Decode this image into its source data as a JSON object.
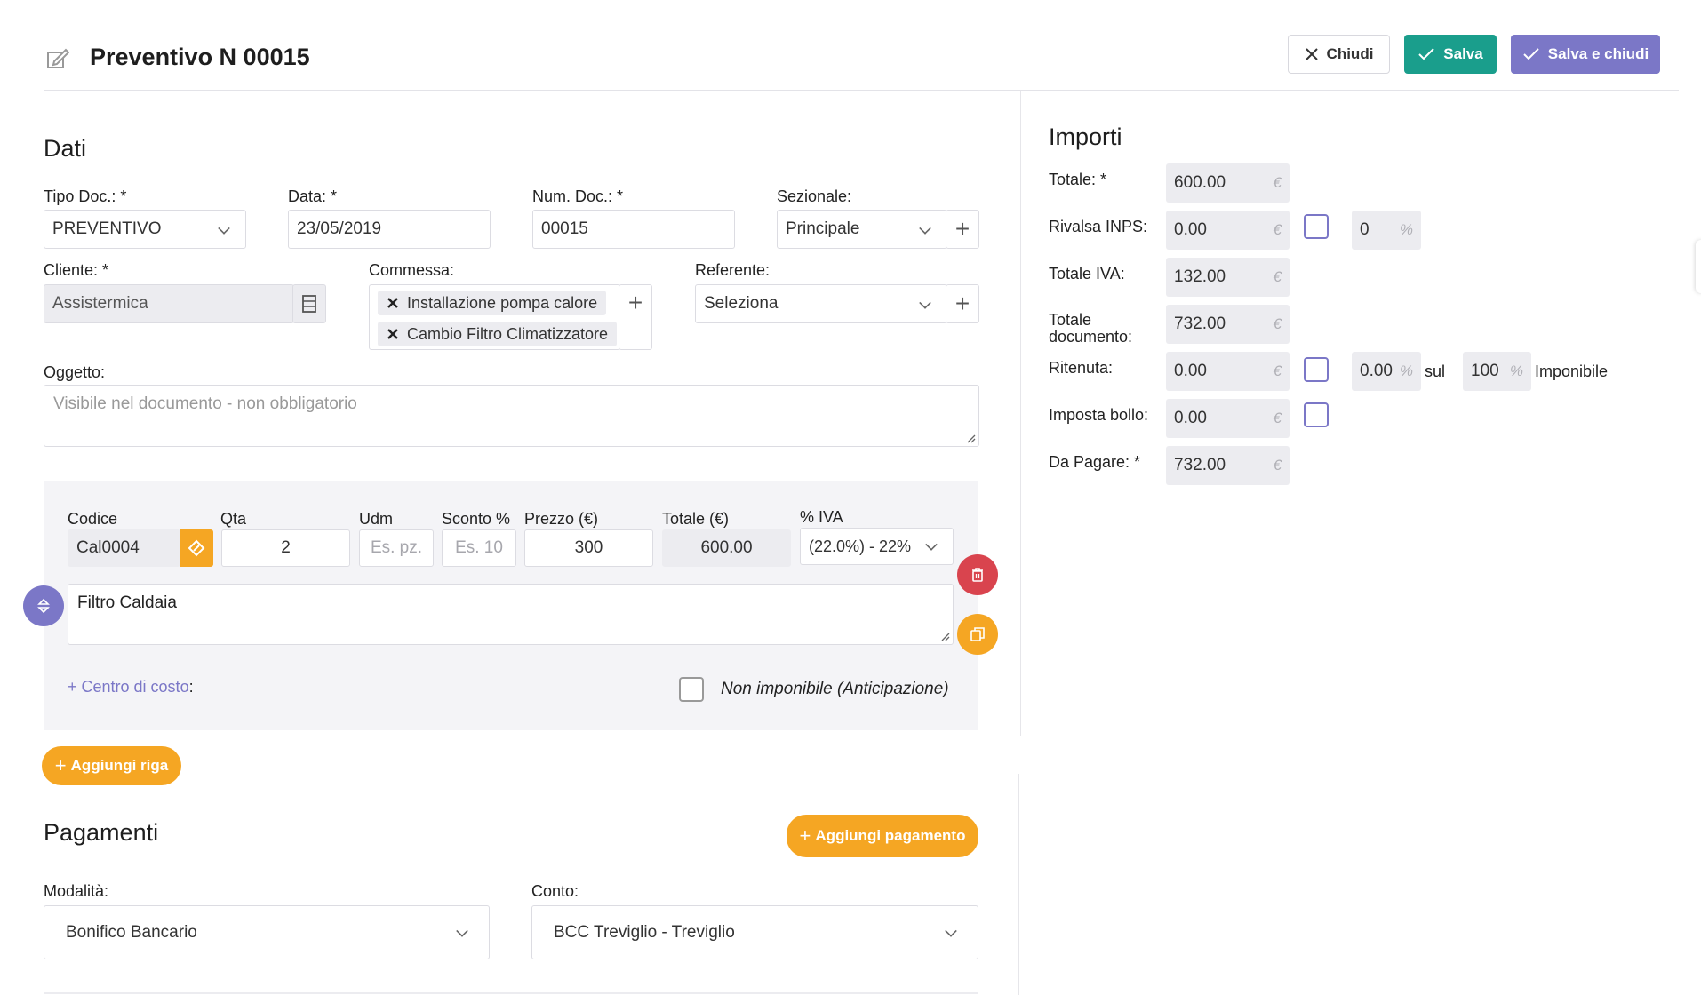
{
  "header": {
    "title": "Preventivo N 00015",
    "close_label": "Chiudi",
    "save_label": "Salva",
    "save_close_label": "Salva e chiudi"
  },
  "dati": {
    "title": "Dati",
    "tipo_doc_label": "Tipo Doc.: *",
    "tipo_doc_value": "PREVENTIVO",
    "data_label": "Data: *",
    "data_value": "23/05/2019",
    "num_doc_label": "Num. Doc.: *",
    "num_doc_value": "00015",
    "sezionale_label": "Sezionale:",
    "sezionale_value": "Principale",
    "cliente_label": "Cliente: *",
    "cliente_value": "Assistermica",
    "commessa_label": "Commessa:",
    "commessa_tags": [
      "Installazione pompa calore",
      "Cambio Filtro Climatizzatore"
    ],
    "referente_label": "Referente:",
    "referente_value": "Seleziona",
    "oggetto_label": "Oggetto:",
    "oggetto_placeholder": "Visibile nel documento - non obbligatorio"
  },
  "riga": {
    "codice_label": "Codice",
    "codice_value": "Cal0004",
    "qta_label": "Qta",
    "qta_value": "2",
    "udm_label": "Udm",
    "udm_placeholder": "Es. pz.",
    "sconto_label": "Sconto %",
    "sconto_placeholder": "Es. 10",
    "prezzo_label": "Prezzo (€)",
    "prezzo_value": "300",
    "totale_label": "Totale (€)",
    "totale_value": "600.00",
    "iva_label": "% IVA",
    "iva_value": "(22.0%) - 22%",
    "descrizione": "Filtro Caldaia",
    "centro_costo_prefix": "+ Centro di costo",
    "centro_costo_colon": ":",
    "non_imponibile": "Non imponibile (Anticipazione)",
    "aggiungi_riga": "Aggiungi riga"
  },
  "pagamenti": {
    "title": "Pagamenti",
    "aggiungi_pagamento": "Aggiungi pagamento",
    "modalita_label": "Modalità:",
    "modalita_value": "Bonifico Bancario",
    "conto_label": "Conto:",
    "conto_value": "BCC Treviglio - Treviglio"
  },
  "importi": {
    "title": "Importi",
    "totale_label": "Totale: *",
    "totale_value": "600.00",
    "rivalsa_label": "Rivalsa INPS:",
    "rivalsa_value": "0.00",
    "rivalsa_pct": "0",
    "totale_iva_label": "Totale IVA:",
    "totale_iva_value": "132.00",
    "totale_doc_label_1": "Totale",
    "totale_doc_label_2": "documento:",
    "totale_doc_value": "732.00",
    "ritenuta_label": "Ritenuta:",
    "ritenuta_value": "0.00",
    "ritenuta_pct": "0.00",
    "sul_label": "sul",
    "imponibile_pct": "100",
    "imponibile_label": "Imponibile",
    "bollo_label": "Imposta bollo:",
    "bollo_value": "0.00",
    "da_pagare_label": "Da Pagare: *",
    "da_pagare_value": "732.00",
    "euro": "€",
    "percent": "%"
  }
}
